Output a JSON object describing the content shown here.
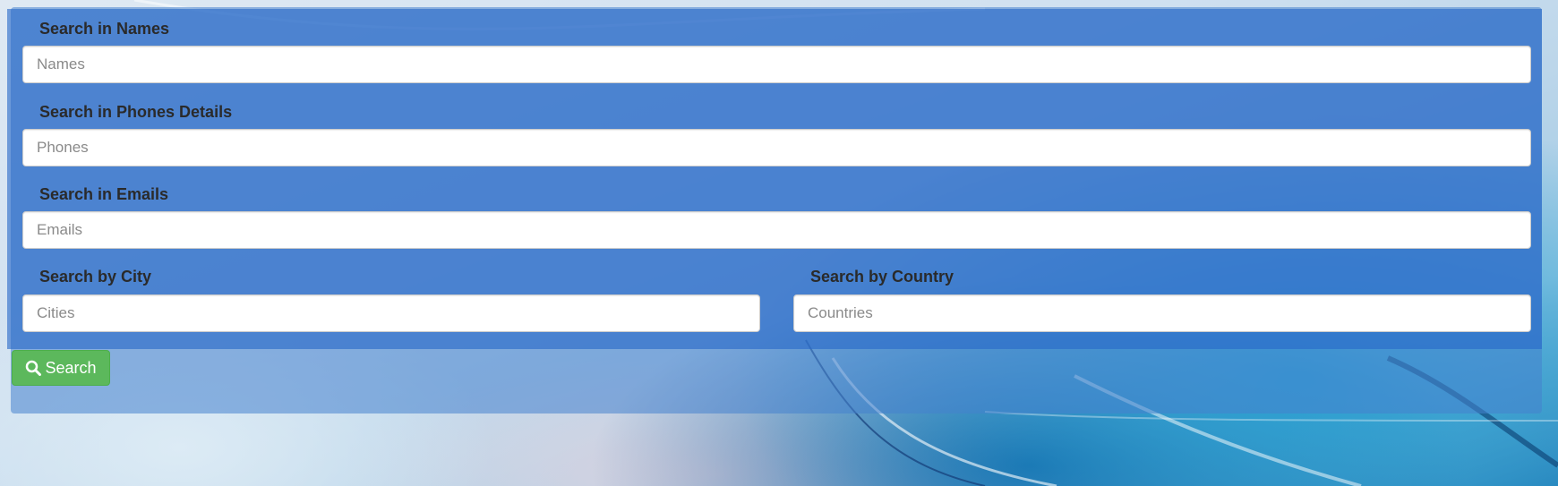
{
  "form": {
    "names": {
      "label": "Search in Names",
      "placeholder": "Names",
      "value": ""
    },
    "phones": {
      "label": "Search in Phones Details",
      "placeholder": "Phones",
      "value": ""
    },
    "emails": {
      "label": "Search in Emails",
      "placeholder": "Emails",
      "value": ""
    },
    "city": {
      "label": "Search by City",
      "placeholder": "Cities",
      "value": ""
    },
    "country": {
      "label": "Search by Country",
      "placeholder": "Countries",
      "value": ""
    }
  },
  "search_button": {
    "label": "Search",
    "icon": "search-icon"
  },
  "colors": {
    "button": "#5cb85c",
    "panel": "#3f7fd0",
    "label_text": "#2a2a2a"
  }
}
